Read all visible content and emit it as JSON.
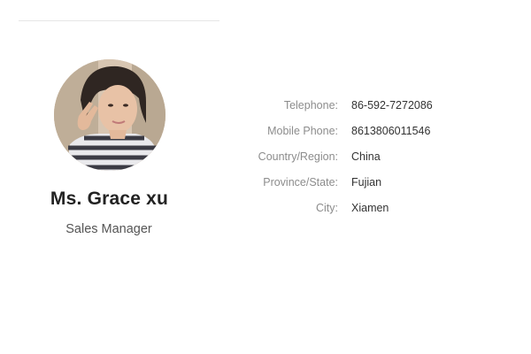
{
  "profile": {
    "avatar_icon": "profile-photo",
    "name": "Ms. Grace xu",
    "role": "Sales Manager"
  },
  "details": [
    {
      "label": "Telephone:",
      "value": "86-592-7272086"
    },
    {
      "label": "Mobile Phone:",
      "value": "8613806011546"
    },
    {
      "label": "Country/Region:",
      "value": "China"
    },
    {
      "label": "Province/State:",
      "value": "Fujian"
    },
    {
      "label": "City:",
      "value": "Xiamen"
    }
  ]
}
